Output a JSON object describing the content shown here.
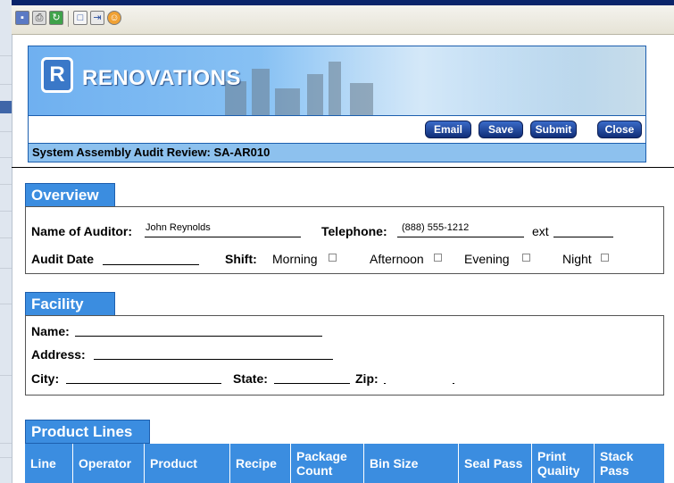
{
  "toolbar": {
    "icons": [
      "save-icon",
      "print-icon",
      "refresh-icon",
      "window-icon",
      "export-icon",
      "help-icon"
    ],
    "colors": {
      "bg": "#ece9d8"
    }
  },
  "banner": {
    "logo_text": "RENOVATIONS"
  },
  "actions": {
    "email": "Email",
    "save": "Save",
    "submit": "Submit",
    "close": "Close"
  },
  "form_title": "System Assembly Audit Review: SA-AR010",
  "overview": {
    "heading": "Overview",
    "auditor_label": "Name of Auditor:",
    "auditor_value": "John Reynolds",
    "telephone_label": "Telephone:",
    "telephone_value": "(888) 555-1212",
    "ext_label": "ext",
    "audit_date_label": "Audit Date",
    "shift_label": "Shift:",
    "shifts": [
      "Morning",
      "Afternoon",
      "Evening",
      "Night"
    ]
  },
  "facility": {
    "heading": "Facility",
    "name_label": "Name:",
    "address_label": "Address:",
    "city_label": "City:",
    "state_label": "State:",
    "zip_label": "Zip:"
  },
  "product_lines": {
    "heading": "Product Lines",
    "columns": [
      "Line",
      "Operator",
      "Product",
      "Recipe",
      "Package Count",
      "Bin Size",
      "Seal Pass",
      "Print Quality",
      "Stack Pass"
    ]
  },
  "colors": {
    "section_blue": "#3b8de0",
    "title_strip": "#8dc1ee",
    "button_navy": "#102e78"
  }
}
